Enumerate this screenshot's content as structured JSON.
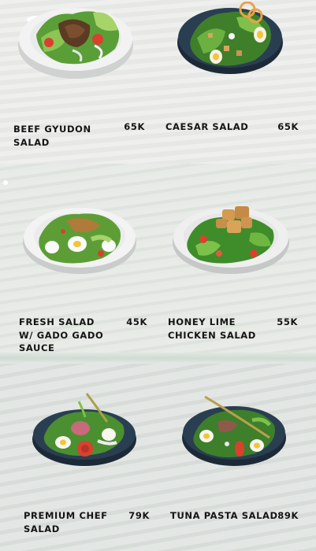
{
  "menu": {
    "items": [
      {
        "name": "BEEF GYUDON\nSALAD",
        "price": "65k"
      },
      {
        "name": "CAESAR SALAD",
        "price": "65k"
      },
      {
        "name": "FRESH SALAD\nW/ GADO GADO\nSAUCE",
        "price": "45k"
      },
      {
        "name": "HONEY LIME\nCHICKEN SALAD",
        "price": "55k"
      },
      {
        "name": "PREMIUM CHEF\nSALAD",
        "price": "79k"
      },
      {
        "name": "TUNA PASTA SALAD",
        "price": "89k"
      }
    ]
  },
  "colors": {
    "text": "#141414",
    "bowl_white": "#f2f2f2",
    "bowl_dark": "#26384a",
    "lettuce": "#4f9a33",
    "tomato": "#d9412e",
    "egg_yolk": "#f2c437",
    "chicken": "#d39a52"
  }
}
